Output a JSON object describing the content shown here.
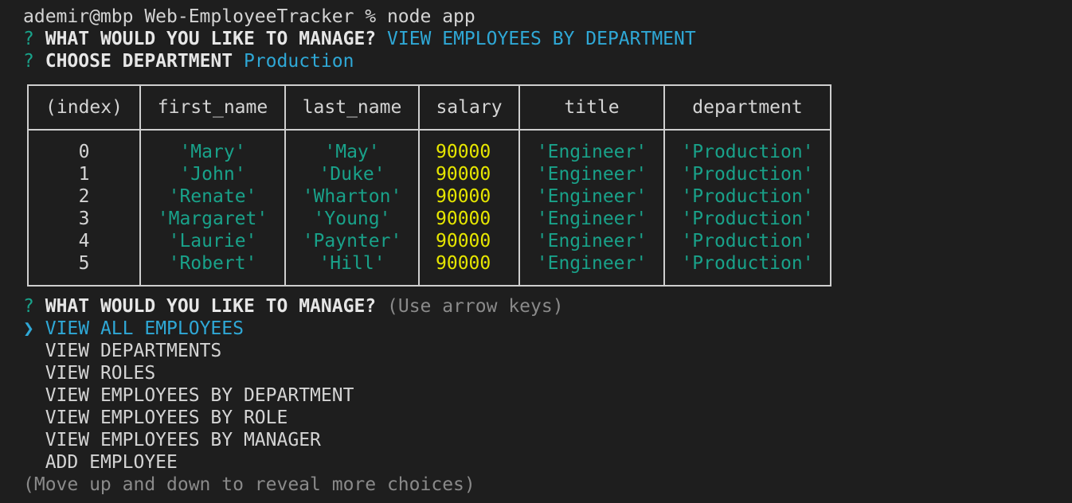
{
  "terminal": {
    "command_line": "ademir@mbp Web-EmployeeTracker % node app",
    "prompt_symbol": "?",
    "q1": {
      "question": "WHAT WOULD YOU LIKE TO MANAGE?",
      "answer": "VIEW EMPLOYEES BY DEPARTMENT"
    },
    "q2": {
      "question": "CHOOSE DEPARTMENT",
      "answer": "Production"
    },
    "q3": {
      "question": "WHAT WOULD YOU LIKE TO MANAGE?",
      "hint": "(Use arrow keys)"
    },
    "pointer": "❯",
    "choices": [
      "VIEW ALL EMPLOYEES",
      "VIEW DEPARTMENTS",
      "VIEW ROLES",
      "VIEW EMPLOYEES BY DEPARTMENT",
      "VIEW EMPLOYEES BY ROLE",
      "VIEW EMPLOYEES BY MANAGER",
      "ADD EMPLOYEE"
    ],
    "footer_hint": "(Move up and down to reveal more choices)"
  },
  "table": {
    "headers": [
      "(index)",
      "first_name",
      "last_name",
      "salary",
      "title",
      "department"
    ],
    "rows": [
      [
        "0",
        "'Mary'",
        "'May'",
        "90000",
        "'Engineer'",
        "'Production'"
      ],
      [
        "1",
        "'John'",
        "'Duke'",
        "90000",
        "'Engineer'",
        "'Production'"
      ],
      [
        "2",
        "'Renate'",
        "'Wharton'",
        "90000",
        "'Engineer'",
        "'Production'"
      ],
      [
        "3",
        "'Margaret'",
        "'Young'",
        "90000",
        "'Engineer'",
        "'Production'"
      ],
      [
        "4",
        "'Laurie'",
        "'Paynter'",
        "90000",
        "'Engineer'",
        "'Production'"
      ],
      [
        "5",
        "'Robert'",
        "'Hill'",
        "90000",
        "'Engineer'",
        "'Production'"
      ]
    ]
  },
  "colors": {
    "background": "#1e1e1e",
    "text": "#d4d4d4",
    "prompt": "#19a28a",
    "answer": "#2fa8d6",
    "string_value": "#19a28a",
    "number_value": "#e6e600",
    "hint": "#8a8a8a"
  }
}
